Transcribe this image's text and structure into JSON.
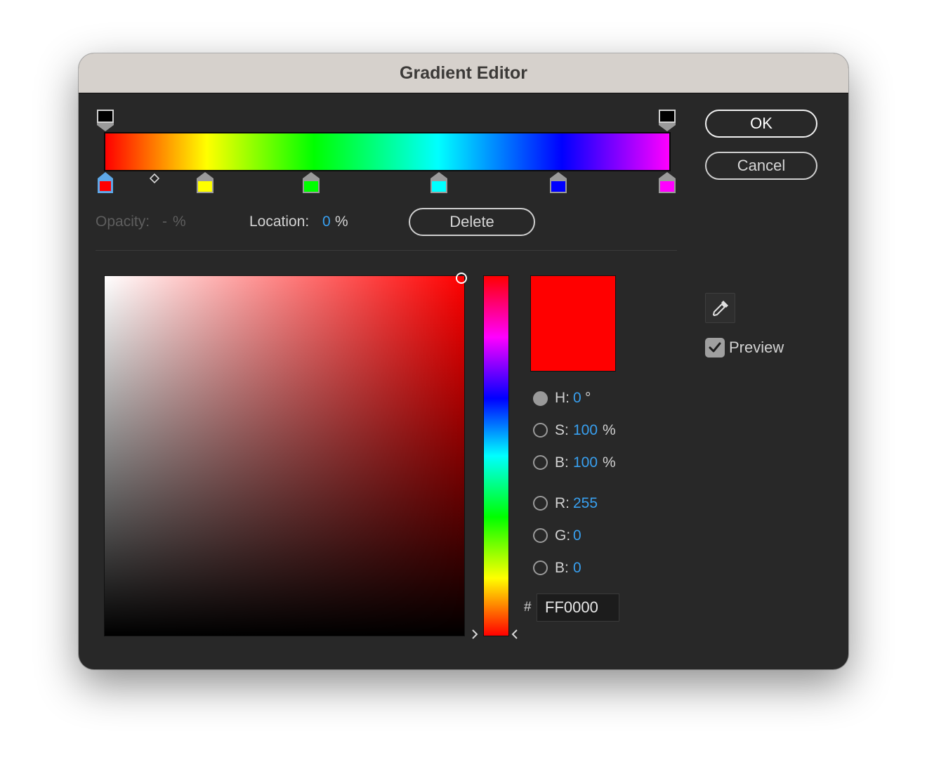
{
  "window": {
    "title": "Gradient Editor"
  },
  "gradient": {
    "stop_colors": [
      "#ff0000",
      "#ffff00",
      "#00ff00",
      "#00ffff",
      "#0000ff",
      "#ff00ff"
    ],
    "selected_stop_color": "#ff0000"
  },
  "stop_settings": {
    "opacity_label": "Opacity:",
    "opacity_value": "-",
    "opacity_unit": "%",
    "location_label": "Location:",
    "location_value": "0",
    "location_unit": "%",
    "delete_label": "Delete"
  },
  "buttons": {
    "ok_label": "OK",
    "cancel_label": "Cancel"
  },
  "color_picker": {
    "current_color": "#ff0000",
    "hsb": {
      "h_label": "H:",
      "h_value": "0",
      "h_unit": "°",
      "s_label": "S:",
      "s_value": "100",
      "s_unit": "%",
      "b_label": "B:",
      "b_value": "100",
      "b_unit": "%"
    },
    "rgb": {
      "r_label": "R:",
      "r_value": "255",
      "g_label": "G:",
      "g_value": "0",
      "b_label": "B:",
      "b_value": "0"
    },
    "hex_symbol": "#",
    "hex_value": "FF0000",
    "selected_mode": "H"
  },
  "preview": {
    "label": "Preview",
    "checked": true
  },
  "icons": {
    "eyedropper": "eyedropper-icon",
    "checkmark": "checkmark-icon",
    "hue_left_arrow": "chevron-right-icon",
    "hue_right_arrow": "chevron-left-icon"
  }
}
